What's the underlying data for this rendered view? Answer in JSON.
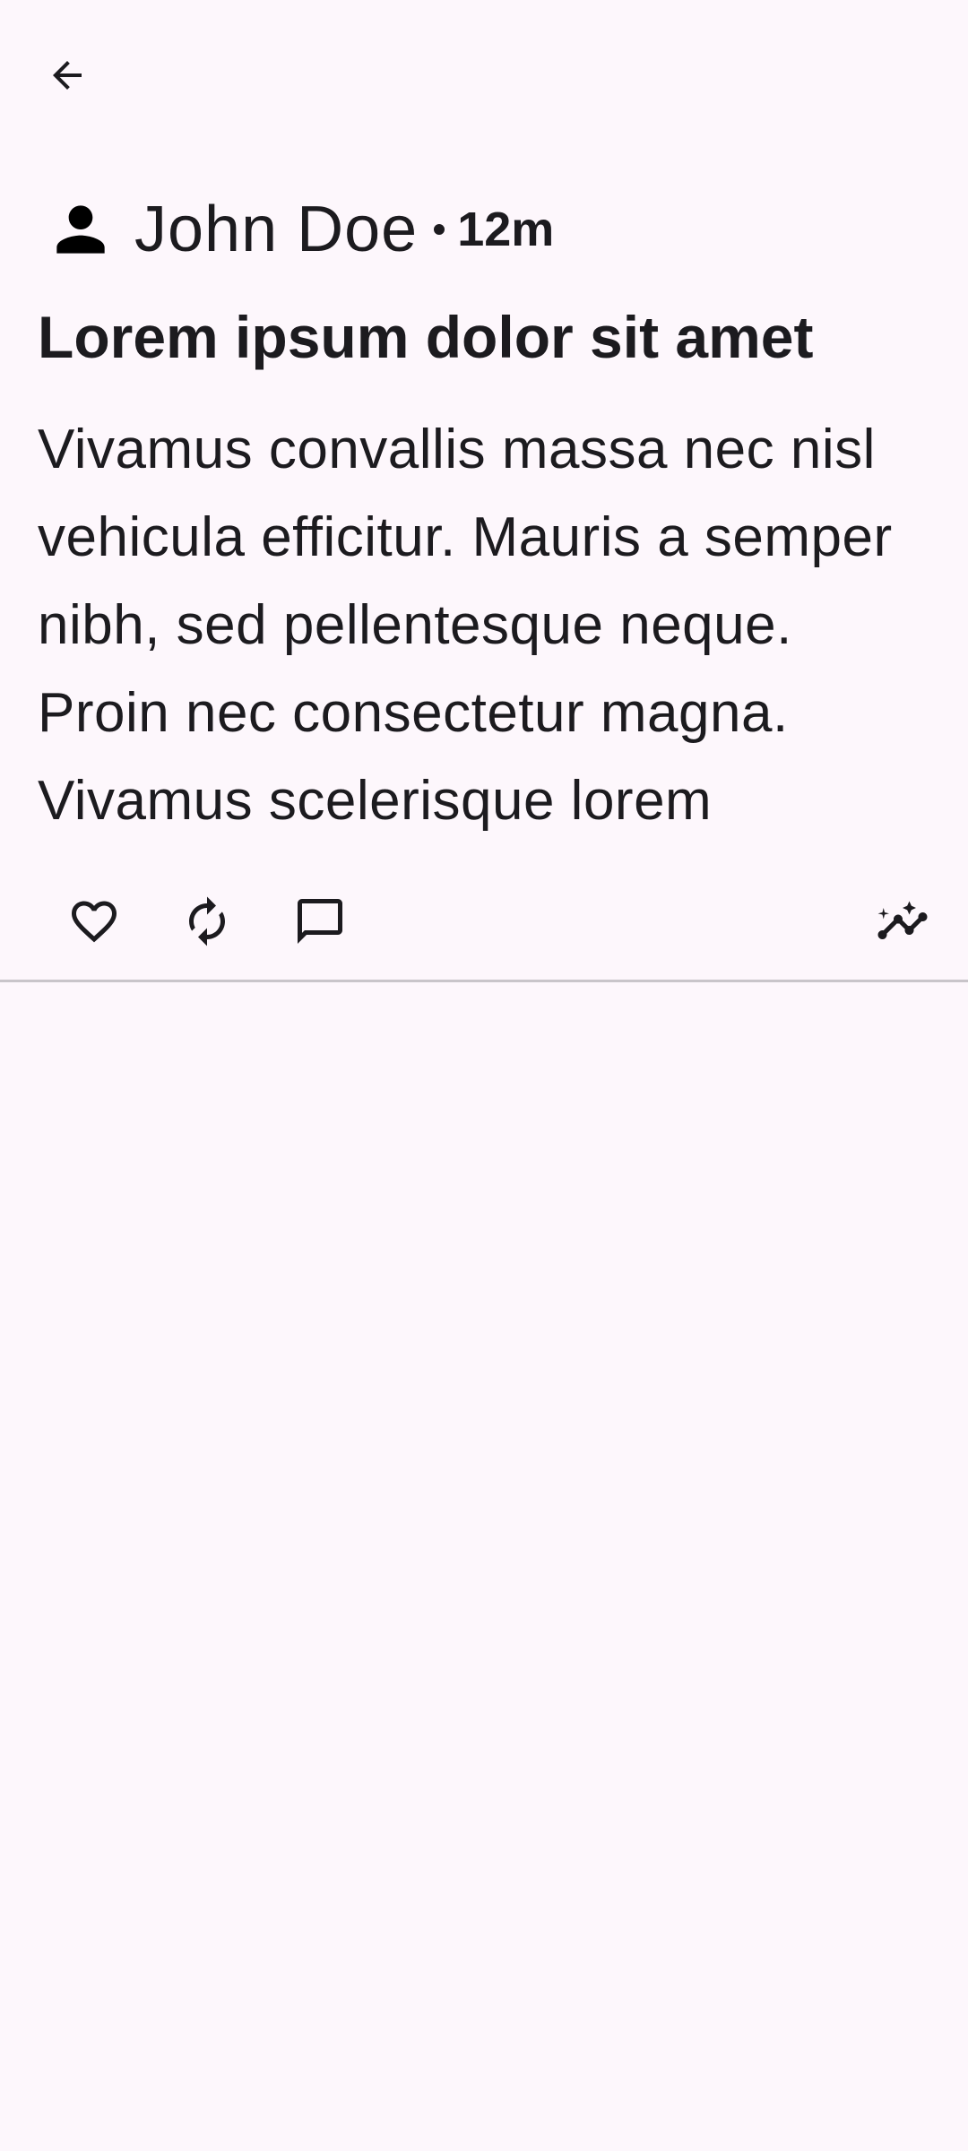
{
  "header": {
    "back_icon": "arrow-back-icon"
  },
  "post": {
    "author": "John Doe",
    "avatar_icon": "person-icon",
    "timestamp": "12m",
    "title": "Lorem ipsum dolor sit amet",
    "body": "Vivamus convallis massa nec nisl vehicula efficitur. Mauris a semper nibh, sed pellentesque neque. Proin nec consectetur magna. Vivamus scelerisque lorem"
  },
  "actions": {
    "like_icon": "heart-outline-icon",
    "repost_icon": "repost-icon",
    "comment_icon": "comment-icon",
    "insights_icon": "insights-icon"
  },
  "colors": {
    "background": "#FDF7FC",
    "text": "#1C1B1F",
    "divider": "#C9C5CA"
  }
}
